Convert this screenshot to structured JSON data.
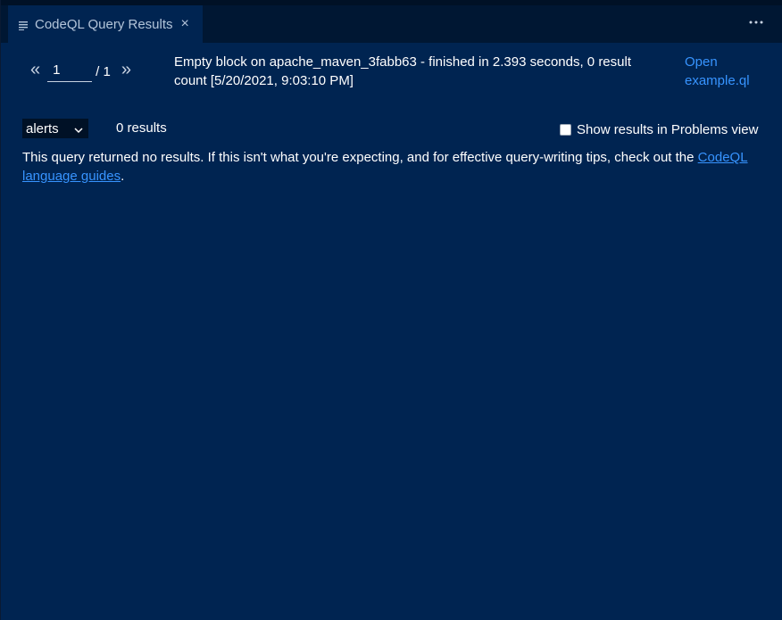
{
  "tab": {
    "title": "CodeQL Query Results",
    "icon": "list-lines-icon",
    "close": "×"
  },
  "toolbar": {
    "more": "more-actions-icon"
  },
  "pager": {
    "prev": "«",
    "current_page": "1",
    "total": "/ 1",
    "next": "»"
  },
  "query": {
    "summary": "Empty block on apache_maven_3fabb63 - finished in 2.393 seconds, 0 result count [5/20/2021, 9:03:10 PM]",
    "open_link": "Open example.ql"
  },
  "results": {
    "result_set": "alerts",
    "count": "0 results",
    "show_in_problems": "Show results in Problems view",
    "show_in_problems_checked": false,
    "no_results_message": "This query returned no results. If this isn't what you're expecting, and for effective query-writing tips, check out the ",
    "guide_link": "CodeQL language guides",
    "message_end": "."
  },
  "colors": {
    "background": "#002451",
    "tabbar": "#001733",
    "link": "#3794ff",
    "text": "#ffffff"
  }
}
